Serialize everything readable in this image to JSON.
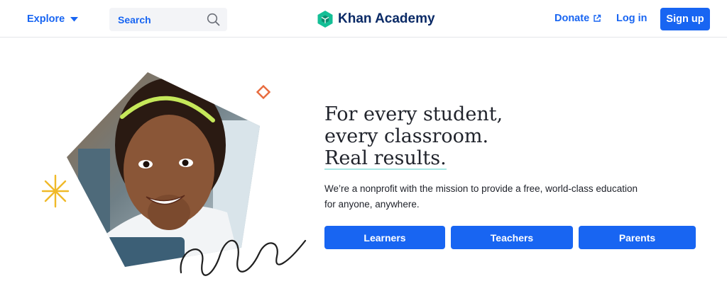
{
  "header": {
    "explore_label": "Explore",
    "search_placeholder": "Search",
    "brand_name": "Khan Academy",
    "donate_label": "Donate",
    "login_label": "Log in",
    "signup_label": "Sign up"
  },
  "hero": {
    "headline_lines": [
      "For every student,",
      "every classroom.",
      "Real results."
    ],
    "tagline": "We’re a nonprofit with the mission to provide a free, world-class education for anyone, anywhere.",
    "buttons": [
      "Learners",
      "Teachers",
      "Parents"
    ]
  },
  "colors": {
    "accent": "#1865f2",
    "brand_green": "#14bf96",
    "brand_text": "#0a2a66",
    "headline_underline": "#a8e8e4",
    "diamond": "#e86a3c",
    "sparkle": "#f0b928"
  },
  "icons": [
    "chevron-down-icon",
    "search-icon",
    "khan-logo-icon",
    "external-link-icon",
    "sparkle-icon",
    "diamond-icon",
    "squiggle-icon"
  ]
}
